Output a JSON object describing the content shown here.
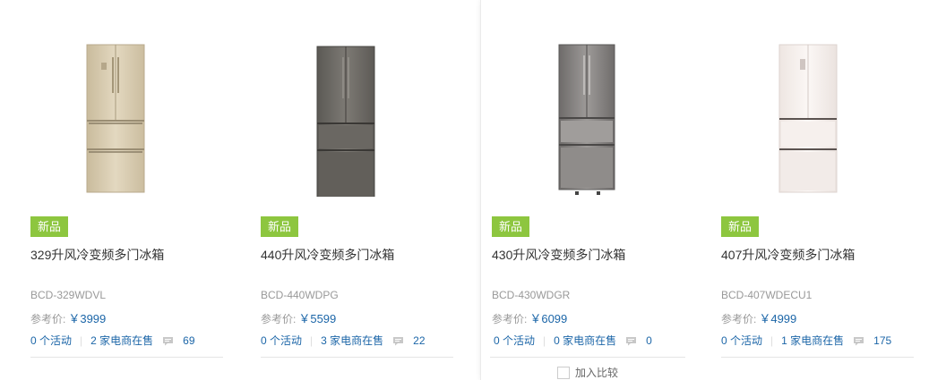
{
  "products": [
    {
      "badge": "新品",
      "title": "329升风冷变频多门冰箱",
      "model": "BCD-329WDVL",
      "price_label": "参考价:",
      "price": "￥3999",
      "activities": "0 个活动",
      "sellers": "2 家电商在售",
      "comments": "69",
      "image_icon": "gold-french-door-fridge-image",
      "body_color": "#d9cdb2"
    },
    {
      "badge": "新品",
      "title": "440升风冷变频多门冰箱",
      "model": "BCD-440WDPG",
      "price_label": "参考价:",
      "price": "￥5599",
      "activities": "0 个活动",
      "sellers": "3 家电商在售",
      "comments": "22",
      "image_icon": "gray-french-door-fridge-image",
      "body_color": "#6b6863"
    },
    {
      "badge": "新品",
      "title": "430升风冷变频多门冰箱",
      "model": "BCD-430WDGR",
      "price_label": "参考价:",
      "price": "￥6099",
      "activities": "0 个活动",
      "sellers": "0 家电商在售",
      "comments": "0",
      "image_icon": "silver-french-door-fridge-image",
      "body_color": "#7b7877",
      "compare_label": "加入比较"
    },
    {
      "badge": "新品",
      "title": "407升风冷变频多门冰箱",
      "model": "BCD-407WDECU1",
      "price_label": "参考价:",
      "price": "￥4999",
      "activities": "0 个活动",
      "sellers": "1 家电商在售",
      "comments": "175",
      "image_icon": "white-french-door-fridge-image",
      "body_color": "#f3ece8"
    }
  ],
  "colors": {
    "badge": "#8dc63f",
    "link": "#1c66a8",
    "muted": "#999999"
  }
}
